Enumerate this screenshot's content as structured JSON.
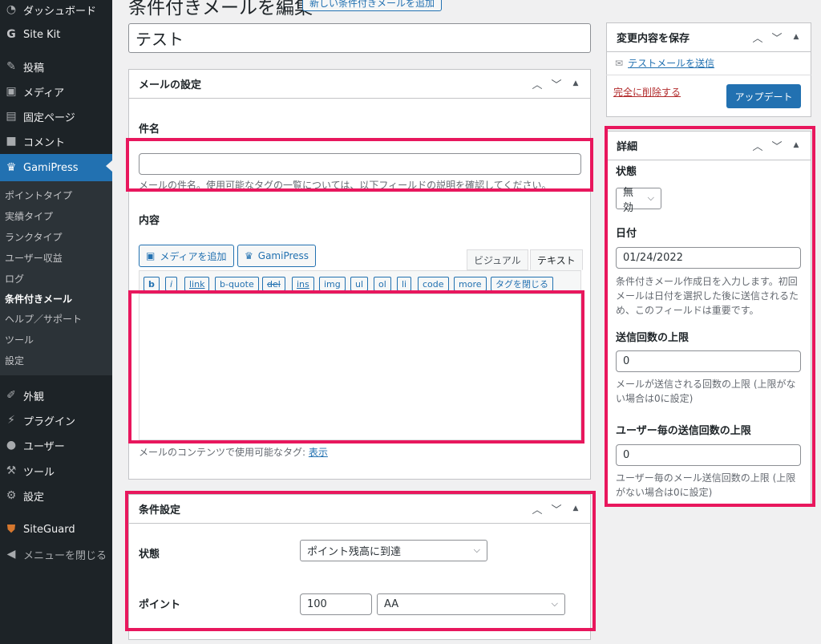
{
  "sidebar": {
    "items": [
      {
        "label": "ダッシュボード",
        "icon": "dashboard-icon"
      },
      {
        "label": "Site Kit",
        "icon": "site-kit-icon"
      },
      {
        "label": "投稿",
        "icon": "pin-icon"
      },
      {
        "label": "メディア",
        "icon": "media-icon"
      },
      {
        "label": "固定ページ",
        "icon": "page-icon"
      },
      {
        "label": "コメント",
        "icon": "comment-icon"
      },
      {
        "label": "GamiPress",
        "icon": "crown-icon"
      },
      {
        "label": "外観",
        "icon": "brush-icon"
      },
      {
        "label": "プラグイン",
        "icon": "plugin-icon"
      },
      {
        "label": "ユーザー",
        "icon": "user-icon"
      },
      {
        "label": "ツール",
        "icon": "wrench-icon"
      },
      {
        "label": "設定",
        "icon": "settings-icon"
      },
      {
        "label": "SiteGuard",
        "icon": "shield-icon"
      },
      {
        "label": "メニューを閉じる",
        "icon": "collapse-icon"
      }
    ],
    "submenu": [
      "ポイントタイプ",
      "実績タイプ",
      "ランクタイプ",
      "ユーザー収益",
      "ログ",
      "条件付きメール",
      "ヘルプ／サポート",
      "ツール",
      "設定"
    ]
  },
  "header": {
    "title": "条件付きメールを編集",
    "add_new": "新しい条件付きメールを追加"
  },
  "post_title": "テスト",
  "mail_settings": {
    "heading": "メールの設定",
    "subject_label": "件名",
    "subject_value": "",
    "subject_desc": "メールの件名。使用可能なタグの一覧については、以下フィールドの説明を確認してください。",
    "content_label": "内容",
    "add_media": "メディアを追加",
    "gamipress": "GamiPress",
    "tab_visual": "ビジュアル",
    "tab_text": "テキスト",
    "quicktags": [
      "b",
      "i",
      "link",
      "b-quote",
      "del",
      "ins",
      "img",
      "ul",
      "ol",
      "li",
      "code",
      "more",
      "タグを閉じる"
    ],
    "content_desc": "メールのコンテンツで使用可能なタグ: ",
    "show_link": "表示"
  },
  "conditions": {
    "heading": "条件設定",
    "status_label": "状態",
    "status_value": "ポイント残高に到達",
    "points_label": "ポイント",
    "points_value": "100",
    "point_type": "AA"
  },
  "publish": {
    "heading": "変更内容を保存",
    "test_mail": "テストメールを送信",
    "delete": "完全に削除する",
    "update": "アップデート"
  },
  "details": {
    "heading": "詳細",
    "status_label": "状態",
    "status_value": "無効",
    "date_label": "日付",
    "date_value": "01/24/2022",
    "date_desc": "条件付きメール作成日を入力します。初回メールは日付を選択した後に送信されるため、このフィールドは重要です。",
    "max_sends_label": "送信回数の上限",
    "max_sends_value": "0",
    "max_sends_desc": "メールが送信される回数の上限 (上限がない場合は0に設定)",
    "max_user_label": "ユーザー毎の送信回数の上限",
    "max_user_value": "0",
    "max_user_desc": "ユーザー毎のメール送信回数の上限 (上限がない場合は0に設定)"
  },
  "colors": {
    "sidebar_bg": "#1d2327",
    "accent": "#2271b1",
    "highlight": "#e8175d"
  }
}
